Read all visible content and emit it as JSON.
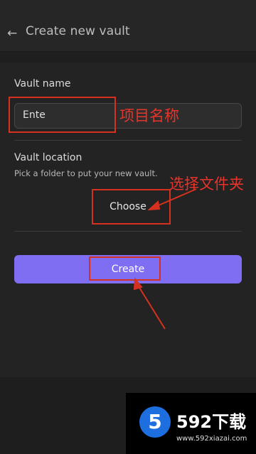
{
  "header": {
    "back_icon": "arrow-left-icon",
    "title": "Create new vault"
  },
  "vault_name": {
    "label": "Vault name",
    "value": "Ente"
  },
  "vault_location": {
    "label": "Vault location",
    "hint": "Pick a folder to put your new vault.",
    "choose_label": "Choose"
  },
  "create_label": "Create",
  "annotations": {
    "name_note": "项目名称",
    "folder_note": "选择文件夹",
    "color": "#d6311f"
  },
  "watermark": {
    "brand": "592下载",
    "url": "www.592xiazai.com",
    "logo_char": "5"
  },
  "colors": {
    "accent": "#7f6df2",
    "background": "#1e1e1e"
  }
}
